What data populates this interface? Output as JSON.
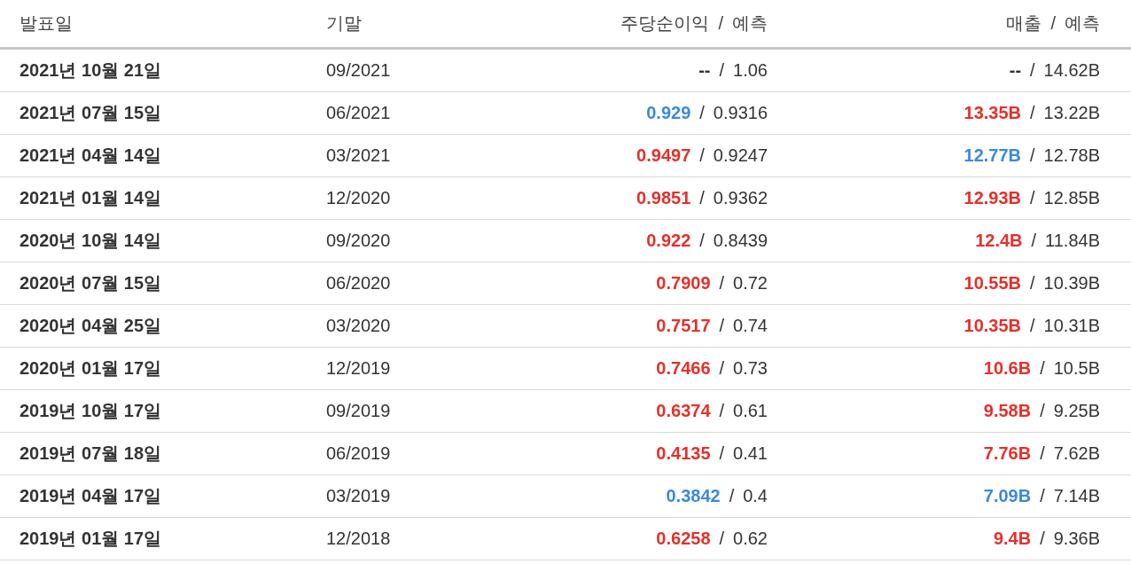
{
  "table": {
    "columns": [
      {
        "label": "발표일"
      },
      {
        "label": "기말"
      },
      {
        "label": "주당순이익",
        "separator": "/",
        "sub": "예측"
      },
      {
        "label": "매출",
        "separator": "/",
        "sub": "예측"
      }
    ],
    "rows": [
      {
        "date": "2021년 10월 21일",
        "period": "09/2021",
        "eps": {
          "actual": "--",
          "color": "#333333",
          "separator": "/",
          "forecast": "1.06"
        },
        "revenue": {
          "actual": "--",
          "color": "#333333",
          "separator": "/",
          "forecast": "14.62B"
        }
      },
      {
        "date": "2021년 07월 15일",
        "period": "06/2021",
        "eps": {
          "actual": "0.929",
          "color": "#3b8ad9",
          "separator": "/",
          "forecast": "0.9316"
        },
        "revenue": {
          "actual": "13.35B",
          "color": "#e5302a",
          "separator": "/",
          "forecast": "13.22B"
        }
      },
      {
        "date": "2021년 04월 14일",
        "period": "03/2021",
        "eps": {
          "actual": "0.9497",
          "color": "#e5302a",
          "separator": "/",
          "forecast": "0.9247"
        },
        "revenue": {
          "actual": "12.77B",
          "color": "#3b8ad9",
          "separator": "/",
          "forecast": "12.78B"
        }
      },
      {
        "date": "2021년 01월 14일",
        "period": "12/2020",
        "eps": {
          "actual": "0.9851",
          "color": "#e5302a",
          "separator": "/",
          "forecast": "0.9362"
        },
        "revenue": {
          "actual": "12.93B",
          "color": "#e5302a",
          "separator": "/",
          "forecast": "12.85B"
        }
      },
      {
        "date": "2020년 10월 14일",
        "period": "09/2020",
        "eps": {
          "actual": "0.922",
          "color": "#e5302a",
          "separator": "/",
          "forecast": "0.8439"
        },
        "revenue": {
          "actual": "12.4B",
          "color": "#e5302a",
          "separator": "/",
          "forecast": "11.84B"
        }
      },
      {
        "date": "2020년 07월 15일",
        "period": "06/2020",
        "eps": {
          "actual": "0.7909",
          "color": "#e5302a",
          "separator": "/",
          "forecast": "0.72"
        },
        "revenue": {
          "actual": "10.55B",
          "color": "#e5302a",
          "separator": "/",
          "forecast": "10.39B"
        }
      },
      {
        "date": "2020년 04월 25일",
        "period": "03/2020",
        "eps": {
          "actual": "0.7517",
          "color": "#e5302a",
          "separator": "/",
          "forecast": "0.74"
        },
        "revenue": {
          "actual": "10.35B",
          "color": "#e5302a",
          "separator": "/",
          "forecast": "10.31B"
        }
      },
      {
        "date": "2020년 01월 17일",
        "period": "12/2019",
        "eps": {
          "actual": "0.7466",
          "color": "#e5302a",
          "separator": "/",
          "forecast": "0.73"
        },
        "revenue": {
          "actual": "10.6B",
          "color": "#e5302a",
          "separator": "/",
          "forecast": "10.5B"
        }
      },
      {
        "date": "2019년 10월 17일",
        "period": "09/2019",
        "eps": {
          "actual": "0.6374",
          "color": "#e5302a",
          "separator": "/",
          "forecast": "0.61"
        },
        "revenue": {
          "actual": "9.58B",
          "color": "#e5302a",
          "separator": "/",
          "forecast": "9.25B"
        }
      },
      {
        "date": "2019년 07월 18일",
        "period": "06/2019",
        "eps": {
          "actual": "0.4135",
          "color": "#e5302a",
          "separator": "/",
          "forecast": "0.41"
        },
        "revenue": {
          "actual": "7.76B",
          "color": "#e5302a",
          "separator": "/",
          "forecast": "7.62B"
        }
      },
      {
        "date": "2019년 04월 17일",
        "period": "03/2019",
        "eps": {
          "actual": "0.3842",
          "color": "#3b8ad9",
          "separator": "/",
          "forecast": "0.4"
        },
        "revenue": {
          "actual": "7.09B",
          "color": "#3b8ad9",
          "separator": "/",
          "forecast": "7.14B"
        }
      },
      {
        "date": "2019년 01월 17일",
        "period": "12/2018",
        "eps": {
          "actual": "0.6258",
          "color": "#e5302a",
          "separator": "/",
          "forecast": "0.62"
        },
        "revenue": {
          "actual": "9.4B",
          "color": "#e5302a",
          "separator": "/",
          "forecast": "9.36B"
        }
      }
    ]
  }
}
